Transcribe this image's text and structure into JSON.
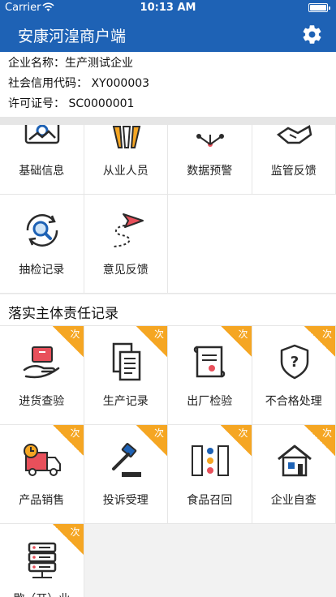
{
  "status_bar": {
    "carrier": "Carrier",
    "time": "10:13 AM"
  },
  "nav": {
    "title": "安康河湟商户端",
    "settings_icon": "gear-icon"
  },
  "company": {
    "name_row": "企业名称：生产测试企业",
    "credit_row": "社会信用代码： XY000003",
    "license_row": "许可证号： SC0000001"
  },
  "top_grid": [
    {
      "label": "基础信息",
      "icon": "basic-info-icon"
    },
    {
      "label": "从业人员",
      "icon": "staff-icon"
    },
    {
      "label": "数据预警",
      "icon": "data-warning-icon"
    },
    {
      "label": "监管反馈",
      "icon": "regulation-feedback-icon"
    },
    {
      "label": "抽检记录",
      "icon": "sampling-record-icon"
    },
    {
      "label": "意见反馈",
      "icon": "opinion-feedback-icon"
    }
  ],
  "section": {
    "title": "落实主体责任记录"
  },
  "badge_text": "次",
  "bottom_grid": [
    {
      "label": "进货查验",
      "icon": "purchase-inspection-icon"
    },
    {
      "label": "生产记录",
      "icon": "production-record-icon"
    },
    {
      "label": "出厂检验",
      "icon": "factory-inspection-icon"
    },
    {
      "label": "不合格处理",
      "icon": "nonconforming-icon"
    },
    {
      "label": "产品销售",
      "icon": "product-sales-icon"
    },
    {
      "label": "投诉受理",
      "icon": "complaint-icon"
    },
    {
      "label": "食品召回",
      "icon": "food-recall-icon"
    },
    {
      "label": "企业自查",
      "icon": "self-inspection-icon"
    },
    {
      "label": "歇（开）业",
      "icon": "server-icon"
    }
  ],
  "colors": {
    "primary": "#1e62b5",
    "badge": "#f5a623",
    "accent_red": "#e8505b",
    "dark": "#2b2b2b"
  }
}
